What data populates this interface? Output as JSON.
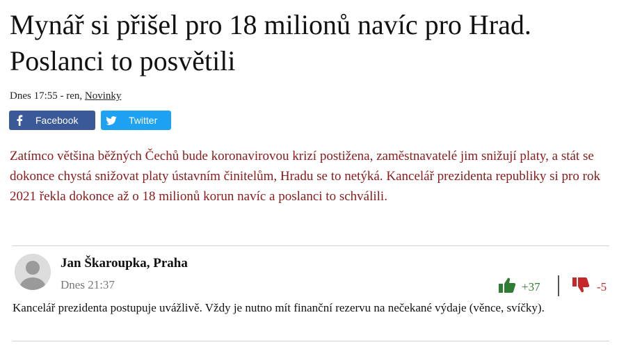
{
  "article": {
    "headline": "Mynář si přišel pro 18 milionů navíc pro Hrad. Poslanci to posvětili",
    "meta_prefix": "Dnes 17:55 - ren, ",
    "source": "Novinky",
    "perex": "Zatímco většina běžných Čechů bude koronavirovou krizí postižena, zaměstnavatelé jim snižují platy, a stát se dokonce chystá snižovat platy ústavním činitelům, Hradu se to netýká. Kancelář prezidenta republiky si pro rok 2021 řekla dokonce až o 18 milionů korun navíc a poslanci to schválili."
  },
  "share": {
    "facebook_label": "Facebook",
    "twitter_label": "Twitter"
  },
  "comment": {
    "author": "Jan Škaroupka, Praha",
    "time": "Dnes 21:37",
    "upvotes": "+37",
    "downvotes": "-5",
    "text": "Kancelář prezidenta postupuje uvážlivě. Vždy je nutno mít finanční rezervu na nečekané výdaje (věnce, svíčky)."
  },
  "colors": {
    "perex": "#8b1a1a",
    "facebook": "#3b5998",
    "twitter": "#1da1f2",
    "upvote": "#2e7d32",
    "downvote": "#c62828"
  },
  "icons": [
    "facebook-icon",
    "twitter-icon",
    "avatar-placeholder-icon",
    "thumbs-up-icon",
    "thumbs-down-icon"
  ]
}
